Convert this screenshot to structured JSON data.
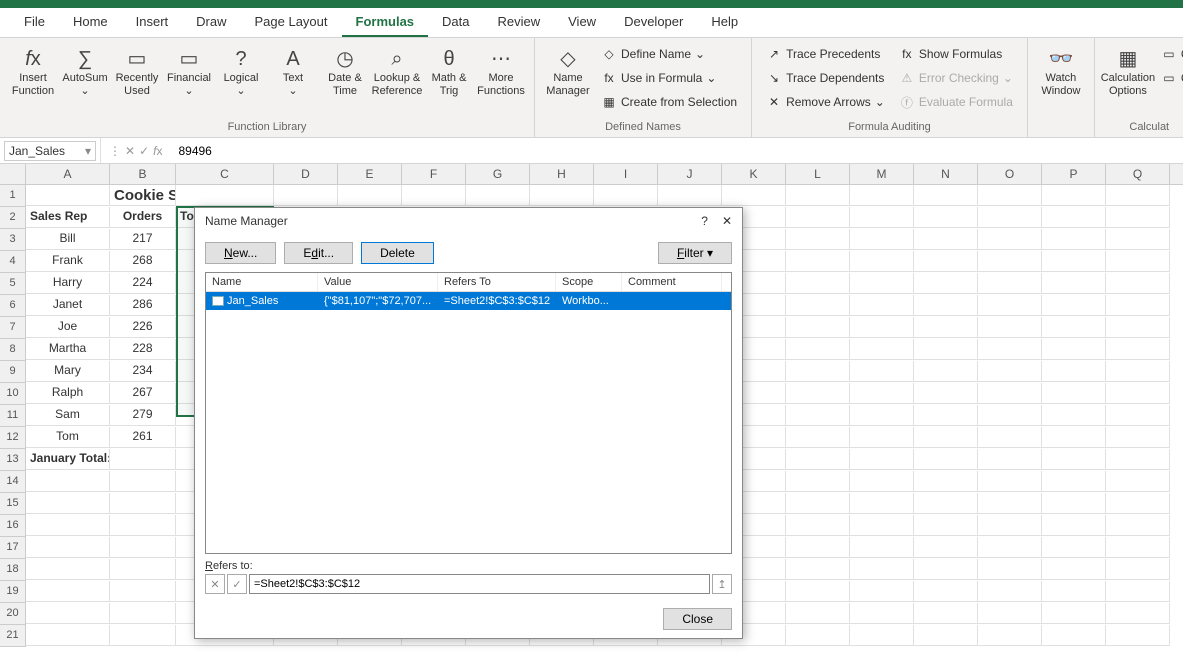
{
  "menu": {
    "tabs": [
      "File",
      "Home",
      "Insert",
      "Draw",
      "Page Layout",
      "Formulas",
      "Data",
      "Review",
      "View",
      "Developer",
      "Help"
    ],
    "active": "Formulas"
  },
  "ribbon": {
    "function_library": {
      "label": "Function Library",
      "insert_function": "Insert\nFunction",
      "autosum": "AutoSum",
      "recently_used": "Recently\nUsed",
      "financial": "Financial",
      "logical": "Logical",
      "text": "Text",
      "date_time": "Date &\nTime",
      "lookup_reference": "Lookup &\nReference",
      "math_trig": "Math &\nTrig",
      "more_functions": "More\nFunctions"
    },
    "defined_names": {
      "label": "Defined Names",
      "name_manager": "Name\nManager",
      "define_name": "Define Name",
      "use_in_formula": "Use in Formula",
      "create_from_selection": "Create from Selection"
    },
    "formula_auditing": {
      "label": "Formula Auditing",
      "trace_precedents": "Trace Precedents",
      "trace_dependents": "Trace Dependents",
      "remove_arrows": "Remove Arrows",
      "show_formulas": "Show Formulas",
      "error_checking": "Error Checking",
      "evaluate_formula": "Evaluate Formula"
    },
    "watch": {
      "label": "Watch\nWindow"
    },
    "calculation": {
      "label": "Calculat",
      "options": "Calculation\nOptions"
    }
  },
  "formula_bar": {
    "name": "Jan_Sales",
    "formula": "89496"
  },
  "columns": [
    "A",
    "B",
    "C",
    "D",
    "E",
    "F",
    "G",
    "H",
    "I",
    "J",
    "K",
    "L",
    "M",
    "N",
    "O",
    "P",
    "Q"
  ],
  "sheet": {
    "title": "Cookie Sale",
    "headers": {
      "a": "Sales Rep",
      "b": "Orders",
      "c": "To"
    },
    "rows": [
      {
        "rep": "Bill",
        "orders": "217"
      },
      {
        "rep": "Frank",
        "orders": "268"
      },
      {
        "rep": "Harry",
        "orders": "224"
      },
      {
        "rep": "Janet",
        "orders": "286"
      },
      {
        "rep": "Joe",
        "orders": "226"
      },
      {
        "rep": "Martha",
        "orders": "228"
      },
      {
        "rep": "Mary",
        "orders": "234"
      },
      {
        "rep": "Ralph",
        "orders": "267"
      },
      {
        "rep": "Sam",
        "orders": "279"
      },
      {
        "rep": "Tom",
        "orders": "261"
      }
    ],
    "footer": "January Total:"
  },
  "dialog": {
    "title": "Name Manager",
    "new": "New...",
    "edit": "Edit...",
    "delete": "Delete",
    "filter": "Filter",
    "cols": {
      "name": "Name",
      "value": "Value",
      "refers": "Refers To",
      "scope": "Scope",
      "comment": "Comment"
    },
    "row": {
      "name": "Jan_Sales",
      "value": "{\"$81,107\";\"$72,707...",
      "refers": "=Sheet2!$C$3:$C$12",
      "scope": "Workbo..."
    },
    "refers_label": "Refers to:",
    "refers_value": "=Sheet2!$C$3:$C$12",
    "close": "Close"
  }
}
